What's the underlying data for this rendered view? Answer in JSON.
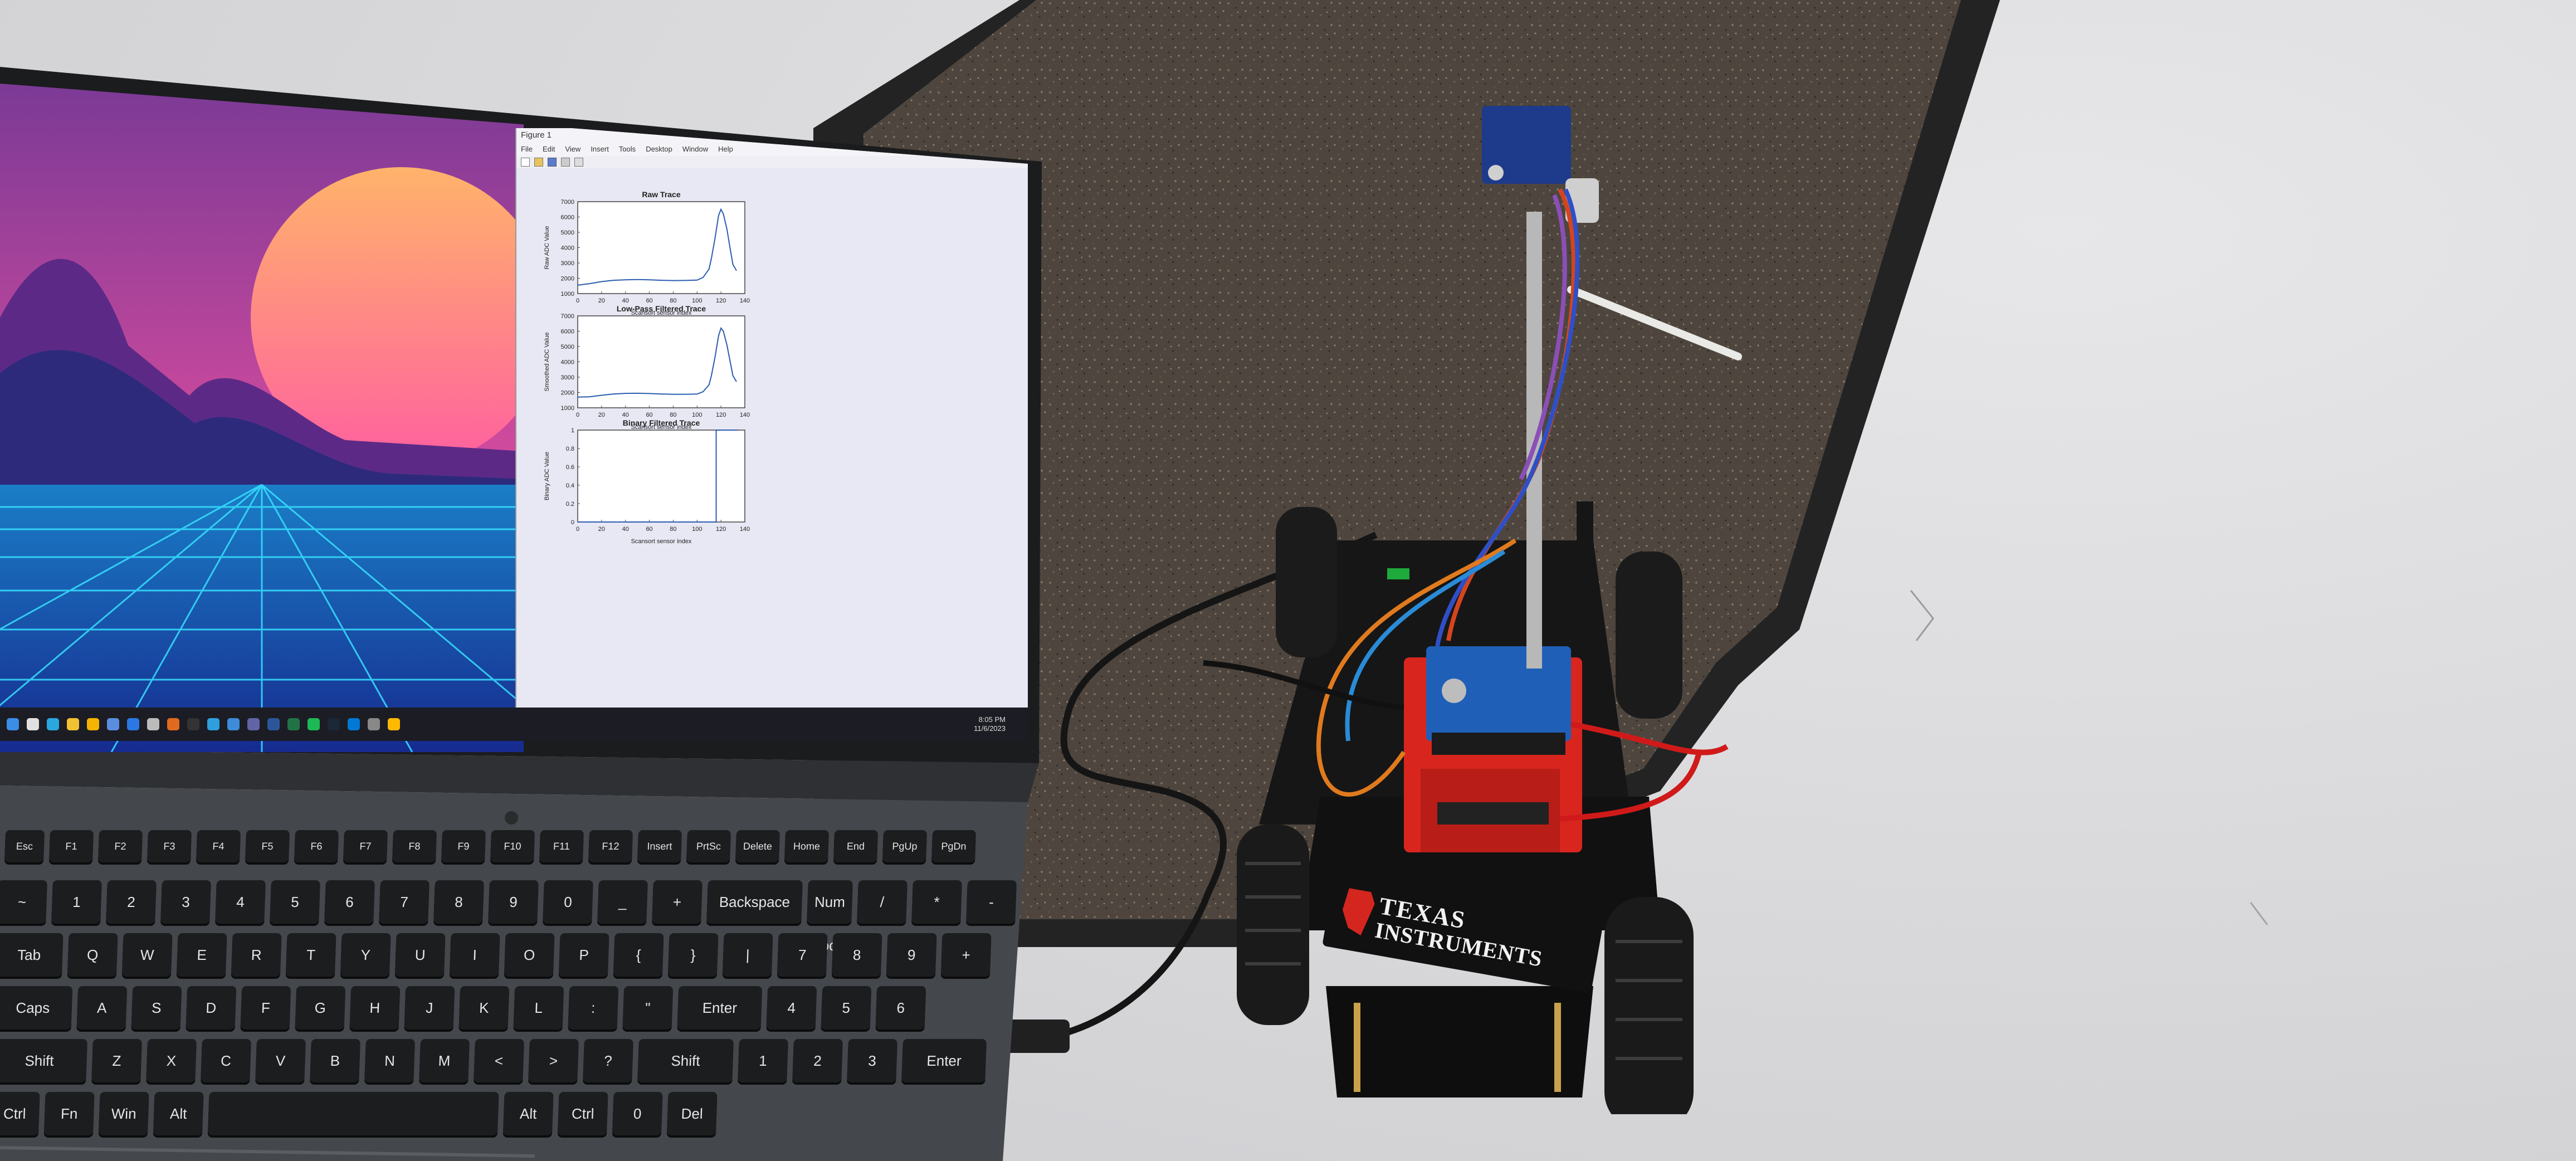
{
  "scene": {
    "floor_color": "#dcdcde",
    "carpet_color": "#4f463d",
    "tape_color": "#232323"
  },
  "laptop": {
    "body_color": "#3c3f42",
    "key_color": "#1c1d1f",
    "key_text_color": "#e6e6e6",
    "icon_names": [
      "start-icon",
      "search-icon",
      "edge-icon",
      "chrome-icon",
      "folder-icon",
      "store-icon",
      "mail-icon",
      "settings-icon",
      "matlab-icon",
      "terminal-icon",
      "photos-icon",
      "calendar-icon",
      "teams-icon",
      "word-icon",
      "excel-icon",
      "spotify-icon",
      "steam-icon",
      "vscode-icon",
      "camera-icon",
      "files-icon"
    ],
    "key_rows": [
      [
        "Esc",
        "F1",
        "F2",
        "F3",
        "F4",
        "F5",
        "F6",
        "F7",
        "F8",
        "F9",
        "F10",
        "F11",
        "F12",
        "Insert",
        "PrtSc",
        "Delete",
        "Home",
        "End",
        "PgUp",
        "PgDn"
      ],
      [
        "~",
        "1",
        "2",
        "3",
        "4",
        "5",
        "6",
        "7",
        "8",
        "9",
        "0",
        "_",
        "+",
        "Backspace",
        "Num Lock",
        "/",
        "*",
        "-"
      ],
      [
        "Tab",
        "Q",
        "W",
        "E",
        "R",
        "T",
        "Y",
        "U",
        "I",
        "O",
        "P",
        "{",
        "}",
        "|",
        "7",
        "8",
        "9",
        "+"
      ],
      [
        "Caps",
        "A",
        "S",
        "D",
        "F",
        "G",
        "H",
        "J",
        "K",
        "L",
        ":",
        "\"",
        "Enter",
        "4",
        "5",
        "6"
      ],
      [
        "Shift",
        "Z",
        "X",
        "C",
        "V",
        "B",
        "N",
        "M",
        "<",
        ">",
        "?",
        "Shift",
        "1",
        "2",
        "3",
        "Enter"
      ],
      [
        "Ctrl",
        "Fn",
        "Win",
        "Alt",
        "",
        "Alt",
        "Ctrl",
        "0",
        "Del"
      ]
    ]
  },
  "figure_window": {
    "title": "Figure 1",
    "menu": [
      "File",
      "Edit",
      "View",
      "Insert",
      "Tools",
      "Desktop",
      "Window",
      "Help"
    ],
    "taskbar_time": "8:05 PM",
    "taskbar_date": "11/6/2023"
  },
  "chart_data": [
    {
      "type": "line",
      "title": "Raw Trace",
      "xlabel": "Scansort sensor index",
      "ylabel": "Raw ADC Value",
      "xlim": [
        0,
        140
      ],
      "ylim": [
        1000,
        7000
      ],
      "xticks": [
        "0",
        "20",
        "40",
        "60",
        "80",
        "100",
        "120",
        "140"
      ],
      "yticks": [
        "1000",
        "2000",
        "3000",
        "4000",
        "5000",
        "6000",
        "7000"
      ],
      "series": [
        {
          "x": [
            0,
            10,
            20,
            30,
            40,
            50,
            60,
            70,
            80,
            90,
            100,
            105,
            110,
            112,
            115,
            118,
            120,
            122,
            125,
            128,
            130,
            133
          ],
          "values": [
            1550,
            1650,
            1780,
            1870,
            1900,
            1920,
            1900,
            1870,
            1850,
            1860,
            1880,
            2050,
            2600,
            3300,
            4600,
            6100,
            6500,
            6200,
            5200,
            3800,
            2900,
            2500
          ]
        }
      ]
    },
    {
      "type": "line",
      "title": "Low-Pass Filtered Trace",
      "xlabel": "Scansort sensor index",
      "ylabel": "Smoothed ADC Value",
      "xlim": [
        0,
        140
      ],
      "ylim": [
        1000,
        7000
      ],
      "xticks": [
        "0",
        "20",
        "40",
        "60",
        "80",
        "100",
        "120",
        "140"
      ],
      "yticks": [
        "1000",
        "2000",
        "3000",
        "4000",
        "5000",
        "6000",
        "7000"
      ],
      "series": [
        {
          "x": [
            0,
            10,
            20,
            30,
            40,
            50,
            60,
            70,
            80,
            90,
            100,
            105,
            110,
            112,
            115,
            118,
            120,
            122,
            125,
            128,
            130,
            133
          ],
          "values": [
            1700,
            1720,
            1820,
            1900,
            1940,
            1950,
            1930,
            1900,
            1880,
            1880,
            1900,
            2050,
            2500,
            3100,
            4300,
            5700,
            6200,
            6000,
            5100,
            3900,
            3100,
            2700
          ]
        }
      ]
    },
    {
      "type": "line",
      "title": "Binary Filtered Trace",
      "xlabel": "Scansort sensor index",
      "ylabel": "Binary ADC Value",
      "xlim": [
        0,
        140
      ],
      "ylim": [
        0,
        1
      ],
      "xticks": [
        "0",
        "20",
        "40",
        "60",
        "80",
        "100",
        "120",
        "140"
      ],
      "yticks": [
        "0",
        "0.2",
        "0.4",
        "0.6",
        "0.8",
        "1"
      ],
      "series": [
        {
          "x": [
            0,
            116,
            116,
            134
          ],
          "values": [
            0,
            0,
            1,
            1
          ]
        }
      ]
    }
  ],
  "robot": {
    "logo_line1": "TEXAS",
    "logo_line2": "INSTRUMENTS",
    "board_color": "#d8261f",
    "shield_color": "#1f5fb8",
    "camera_color": "#1e3a8a"
  }
}
